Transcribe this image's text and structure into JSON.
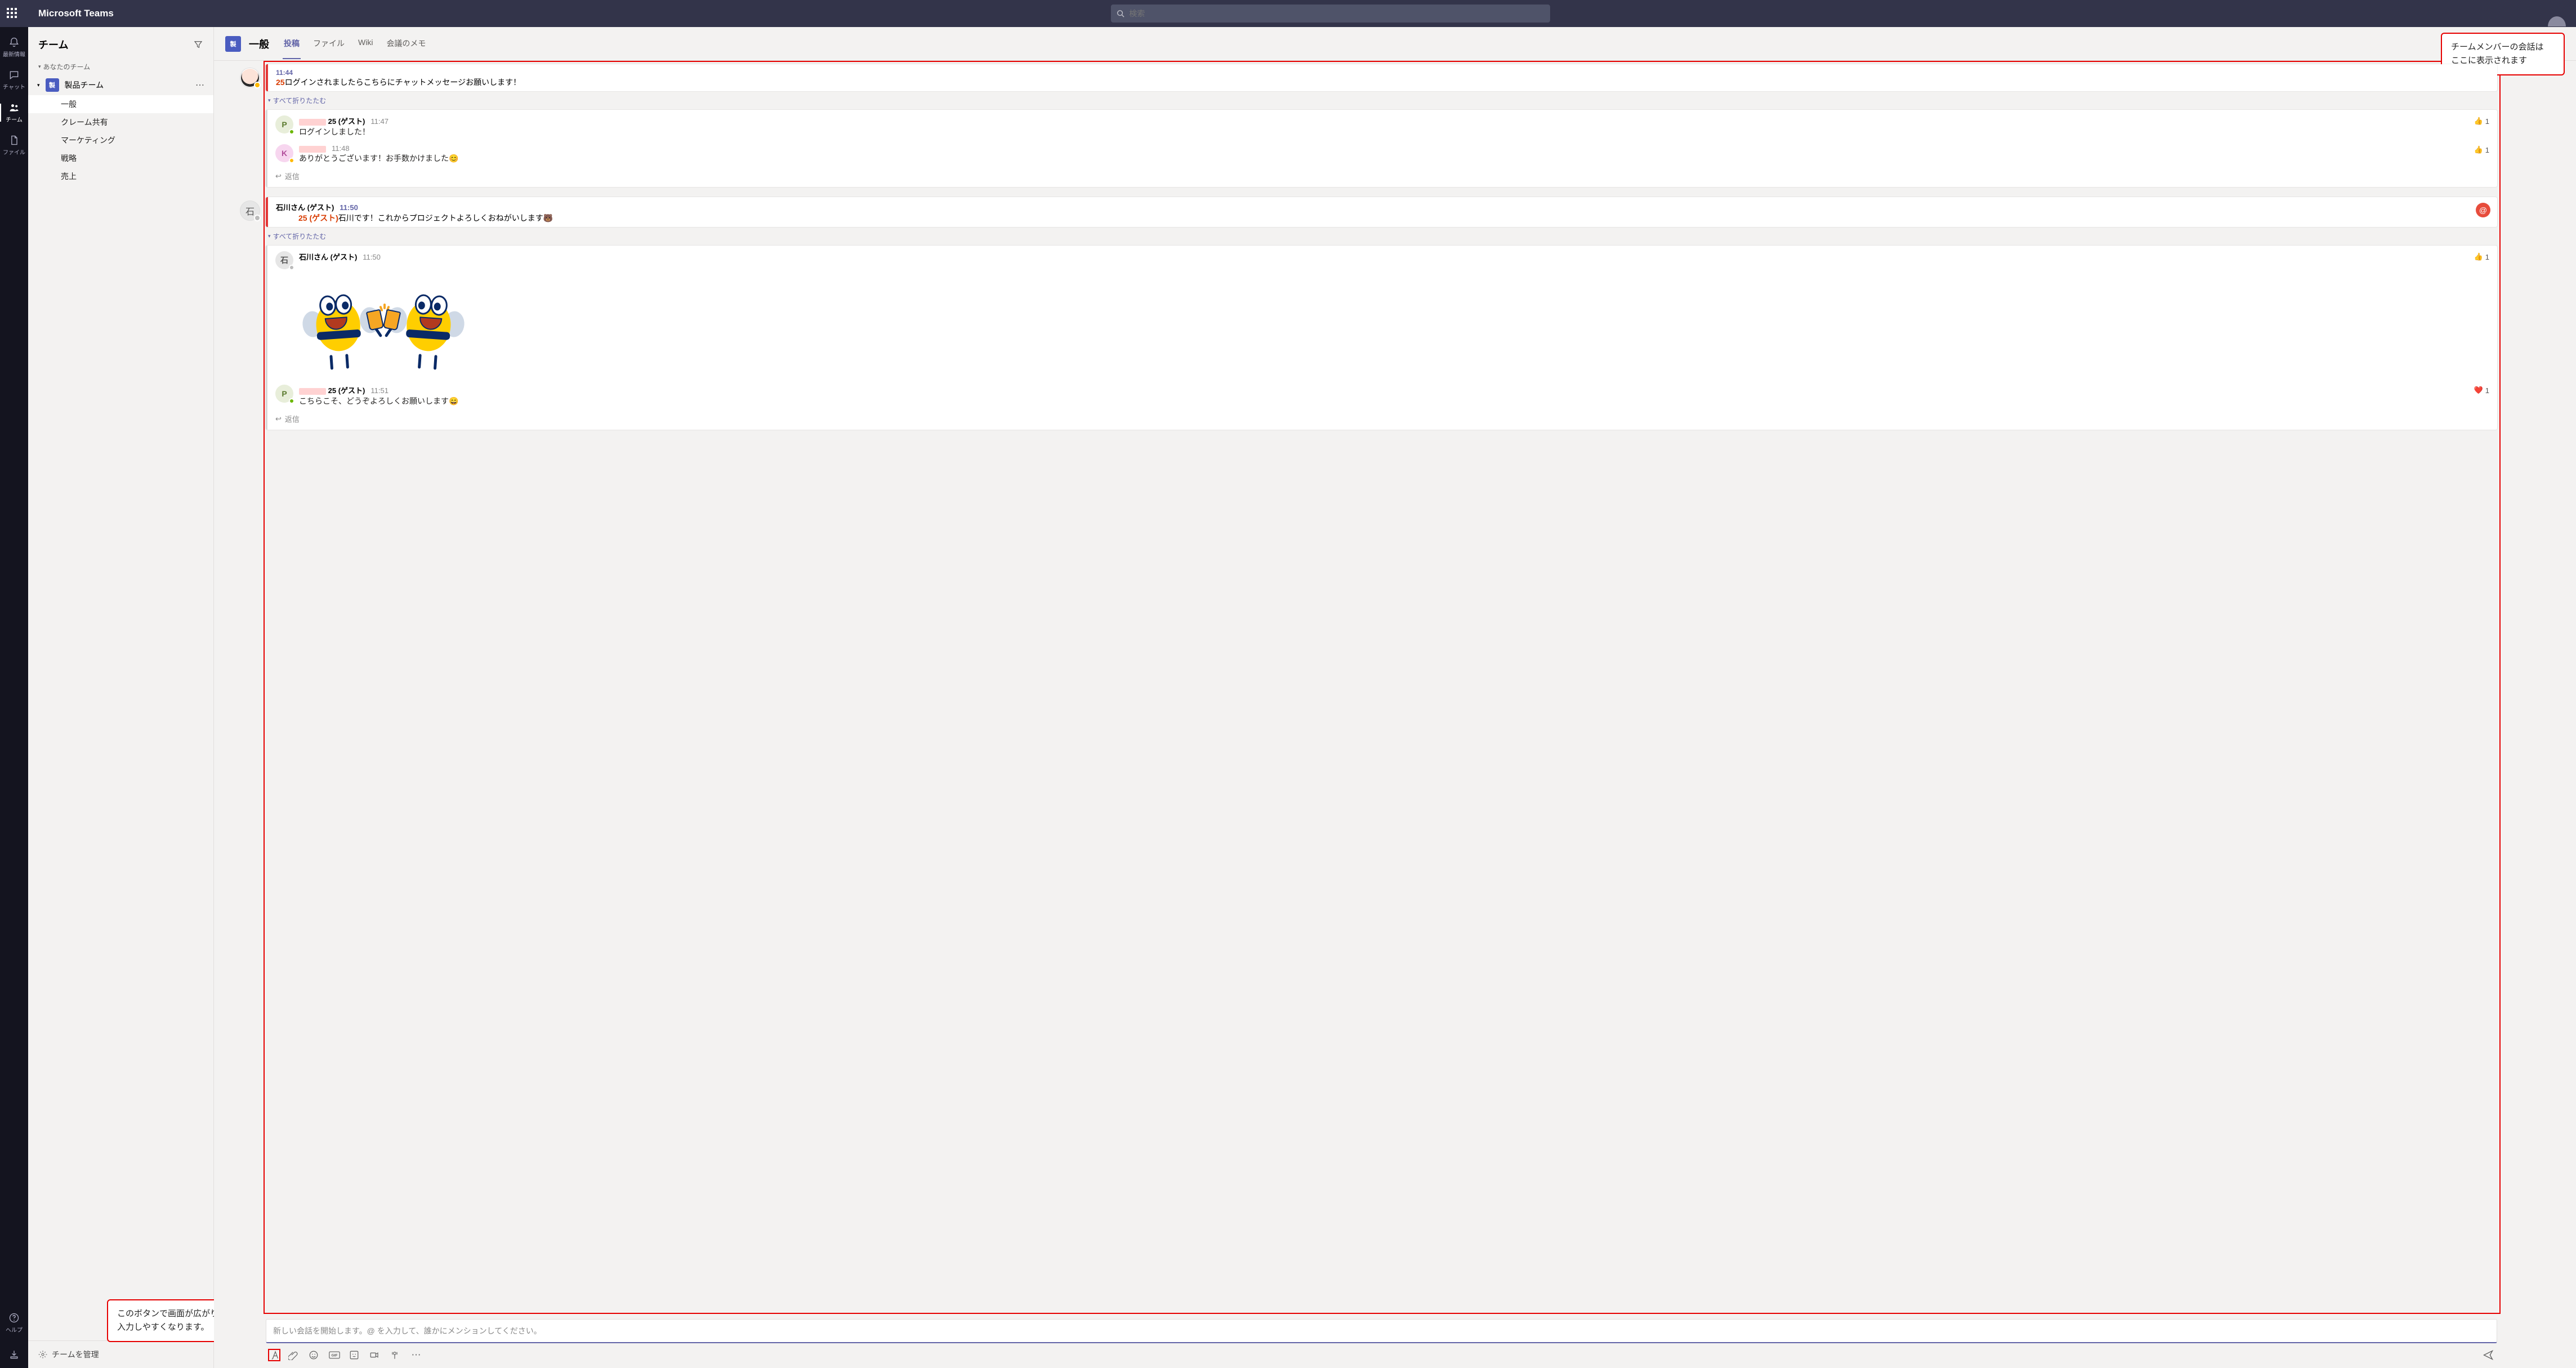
{
  "app_title": "Microsoft Teams",
  "search": {
    "placeholder": "検索"
  },
  "rail": {
    "items": [
      {
        "id": "activity",
        "label": "最新情報",
        "icon": "bell"
      },
      {
        "id": "chat",
        "label": "チャット",
        "icon": "chat"
      },
      {
        "id": "teams",
        "label": "チーム",
        "icon": "teams",
        "active": true
      },
      {
        "id": "files",
        "label": "ファイル",
        "icon": "file"
      }
    ],
    "help_label": "ヘルプ"
  },
  "teamlist": {
    "header": "チーム",
    "section_label": "あなたのチーム",
    "team_name": "製品チーム",
    "team_initial": "製",
    "channels": [
      {
        "name": "一般",
        "active": true
      },
      {
        "name": "クレーム共有"
      },
      {
        "name": "マーケティング"
      },
      {
        "name": "戦略"
      },
      {
        "name": "売上"
      }
    ],
    "footer": "チームを管理"
  },
  "conversation": {
    "channel_name": "一般",
    "team_initial": "製",
    "tabs": [
      {
        "label": "投稿",
        "active": true
      },
      {
        "label": "ファイル"
      },
      {
        "label": "Wiki"
      },
      {
        "label": "会議のメモ"
      }
    ],
    "collapse_label": "すべて折りたたむ",
    "reply_label": "返信",
    "threads": [
      {
        "avatar_type": "face",
        "head_time": "11:44",
        "head_tag": "25",
        "head_text": "ログインされましたらこちらにチャットメッセージお願いします！",
        "replies": [
          {
            "avatar_letter": "P",
            "avatar_bg": "#e8eeda",
            "avatar_fg": "#5a7a2e",
            "dot": "#6bb700",
            "name_suffix": "25 (ゲスト)",
            "time": "11:47",
            "text": "ログインしました！",
            "reaction": {
              "emoji": "👍",
              "count": 1
            }
          },
          {
            "avatar_letter": "K",
            "avatar_bg": "#f7d6ef",
            "avatar_fg": "#b14e9b",
            "dot": "#ffb900",
            "time": "11:48",
            "text": "ありがとうございます！お手数かけました😊",
            "reaction": {
              "emoji": "👍",
              "count": 1
            }
          }
        ]
      },
      {
        "avatar_type": "initial",
        "avatar_text": "石",
        "avatar_bg": "#e6e6e6",
        "avatar_fg": "#555",
        "head_name": "石川さん (ゲスト)",
        "head_time": "11:50",
        "head_tag": "25 (ゲスト)",
        "head_text": "石川です！これからプロジェクトよろしくおねがいします🐻",
        "mention_badge": "@",
        "replies": [
          {
            "avatar_letter": "石",
            "avatar_bg": "#e6e6e6",
            "avatar_fg": "#555",
            "dot": "#bbb",
            "name": "石川さん (ゲスト)",
            "time": "11:50",
            "sticker": true,
            "reaction": {
              "emoji": "👍",
              "count": 1
            }
          },
          {
            "avatar_letter": "P",
            "avatar_bg": "#e8eeda",
            "avatar_fg": "#5a7a2e",
            "dot": "#6bb700",
            "name_suffix": "25 (ゲスト)",
            "time": "11:51",
            "text": "こちらこそ、どうぞよろしくお願いします😄",
            "reaction": {
              "emoji": "❤️",
              "count": 1
            }
          }
        ]
      }
    ]
  },
  "composer": {
    "placeholder": "新しい会話を開始します。@ を入力して、誰かにメンションしてください。"
  },
  "annotations": {
    "top_right": "チームメンバーの会話は\nここに表示されます",
    "bottom_left": "このボタンで画面が広がり\n入力しやすくなります。"
  }
}
